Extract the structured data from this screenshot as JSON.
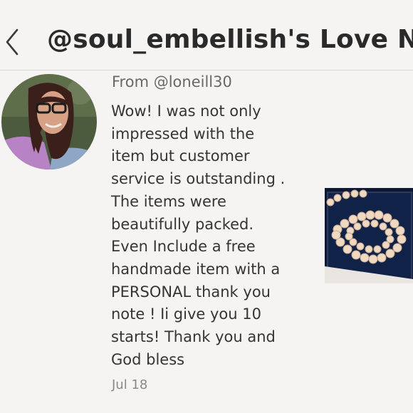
{
  "header": {
    "title": "@soul_embellish's Love No..",
    "back_icon": "chevron-left-icon"
  },
  "note": {
    "from": "From @loneill30",
    "lines": [
      "Wow! I was not only",
      "impressed with the",
      "item but customer",
      "service is outstanding .",
      "The items were",
      "beautifully packed.",
      "Even Include a free",
      "handmade item with a",
      "PERSONAL thank you",
      "note ! Ii give you 10",
      "starts! Thank you and",
      "God bless"
    ],
    "date": "Jul 18"
  },
  "colors": {
    "background": "#f6f4f3",
    "title": "#2a2a2a",
    "text": "#373433",
    "muted": "#6b6764"
  }
}
